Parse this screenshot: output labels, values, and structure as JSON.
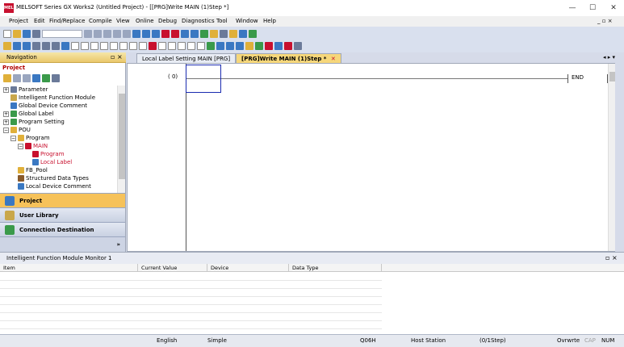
{
  "window": {
    "title": "MELSOFT Series GX Works2 (Untitled Project) - [[PRG]Write MAIN (1)Step *]",
    "logo_text": "MELSOFT",
    "minimize_label": "—",
    "maximize_label": "☐",
    "close_label": "✕"
  },
  "menu": {
    "items": [
      "Project",
      "Edit",
      "Find/Replace",
      "Compile",
      "View",
      "Online",
      "Debug",
      "Diagnostics",
      "Tool",
      "Window",
      "Help"
    ],
    "child_controls": "_ ▫ ×"
  },
  "navigation": {
    "title": "Navigation",
    "pin": "▫ ×",
    "section_label": "Project",
    "tree": [
      {
        "label": "Parameter",
        "expander": "+",
        "level": 0,
        "icon_color": "#6b7a99"
      },
      {
        "label": "Intelligent Function Module",
        "expander": "",
        "level": 0,
        "icon_color": "#c9a74b"
      },
      {
        "label": "Global Device Comment",
        "expander": "",
        "level": 0,
        "icon_color": "#3a78c2"
      },
      {
        "label": "Global Label",
        "expander": "+",
        "level": 0,
        "icon_color": "#3a9a4a"
      },
      {
        "label": "Program Setting",
        "expander": "+",
        "level": 0,
        "icon_color": "#3a9a4a"
      },
      {
        "label": "POU",
        "expander": "−",
        "level": 0,
        "icon_color": "#e0b03a"
      },
      {
        "label": "Program",
        "expander": "−",
        "level": 1,
        "icon_color": "#e0b03a"
      },
      {
        "label": "MAIN",
        "expander": "−",
        "level": 2,
        "icon_color": "#c8102e",
        "red": true
      },
      {
        "label": "Program",
        "expander": "",
        "level": 3,
        "icon_color": "#c8102e",
        "red": true
      },
      {
        "label": "Local Label",
        "expander": "",
        "level": 3,
        "icon_color": "#3a78c2",
        "red": true
      },
      {
        "label": "FB_Pool",
        "expander": "",
        "level": 1,
        "icon_color": "#e0b03a"
      },
      {
        "label": "Structured Data Types",
        "expander": "",
        "level": 1,
        "icon_color": "#8a5a2a"
      },
      {
        "label": "Local Device Comment",
        "expander": "",
        "level": 1,
        "icon_color": "#3a78c2"
      }
    ],
    "buttons": [
      {
        "label": "Project",
        "active": true,
        "icon_color": "#3a78c2"
      },
      {
        "label": "User Library",
        "active": false,
        "icon_color": "#c9a74b"
      },
      {
        "label": "Connection Destination",
        "active": false,
        "icon_color": "#3a9a4a"
      }
    ],
    "more": "»"
  },
  "tabs": [
    {
      "label": "Local Label Setting MAIN [PRG]",
      "active": false
    },
    {
      "label": "[PRG]Write MAIN (1)Step *",
      "active": true
    }
  ],
  "tab_nav": "◂ ▸ ▾",
  "ladder": {
    "step_label": "(   0)",
    "end_label": "END"
  },
  "monitor": {
    "title": "Intelligent Function Module Monitor 1",
    "pin": "▫ ×",
    "columns": [
      "Item",
      "Current Value",
      "Device",
      "Data Type"
    ]
  },
  "status": {
    "language": "English",
    "mode": "Simple",
    "cpu": "Q06H",
    "station": "Host Station",
    "step": "(0/1Step)",
    "overwrite": "Ovrwrte",
    "caps": "CAP",
    "num": "NUM"
  },
  "colors": {
    "active_nav": "#f6c25a",
    "active_tab": "#f6d77a",
    "cursor": "#1a2bb0",
    "accent_red": "#c8102e"
  }
}
